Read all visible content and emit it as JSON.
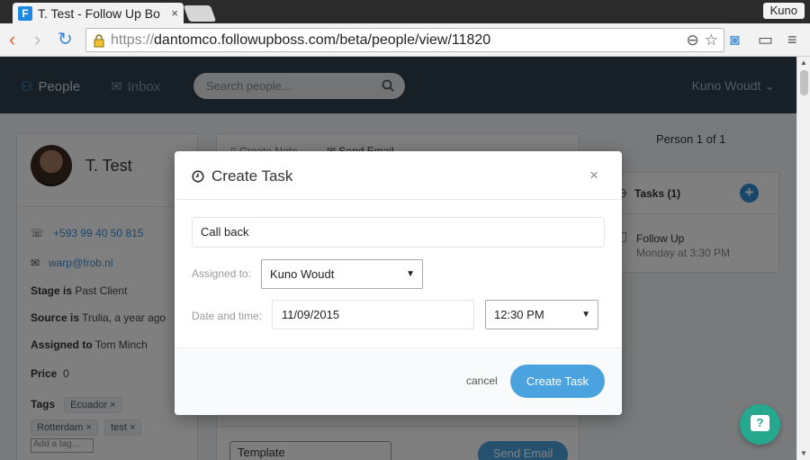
{
  "browser": {
    "tab_title": "T. Test - Follow Up Bo",
    "favicon_letter": "F",
    "tab_close": "×",
    "profile_name": "Kuno",
    "url_scheme": "https://",
    "url_rest": "dantomco.followupboss.com/beta/people/view/11820"
  },
  "nav": {
    "people_label": "People",
    "inbox_label": "Inbox",
    "search_placeholder": "Search people...",
    "user_name": "Kuno Woudt"
  },
  "person": {
    "name": "T. Test",
    "phone": "+593 99 40 50 815",
    "email": "warp@frob.nl",
    "stage_label": "Stage is",
    "stage_value": "Past Client",
    "source_label": "Source is",
    "source_value": "Trulia, a year ago",
    "assigned_label": "Assigned to",
    "assigned_value": "Tom Minch",
    "price_label": "Price",
    "price_value": "0",
    "tags_label": "Tags",
    "tags": [
      "Ecuador",
      "Rotterdam",
      "test"
    ],
    "add_tag_placeholder": "Add a tag..."
  },
  "compose": {
    "create_note": "Create Note",
    "send_email": "Send Email",
    "template_label": "Template",
    "send_email_button": "Send Email"
  },
  "sidebar": {
    "person_count": "Person 1 of 1",
    "tasks_title": "Tasks (1)",
    "task_name": "Follow Up",
    "task_when": "Monday at 3:30 PM"
  },
  "modal": {
    "title": "Create Task",
    "close": "×",
    "task_value": "Call back",
    "assigned_label": "Assigned to:",
    "assigned_value": "Kuno Woudt",
    "date_label": "Date and time:",
    "date_value": "11/09/2015",
    "time_value": "12:30 PM",
    "cancel_label": "cancel",
    "create_label": "Create Task"
  },
  "help": {
    "glyph": "?"
  },
  "colors": {
    "accent": "#4aa3df",
    "nav_bg": "#2f3e4e",
    "help_bg": "#26a88f"
  }
}
